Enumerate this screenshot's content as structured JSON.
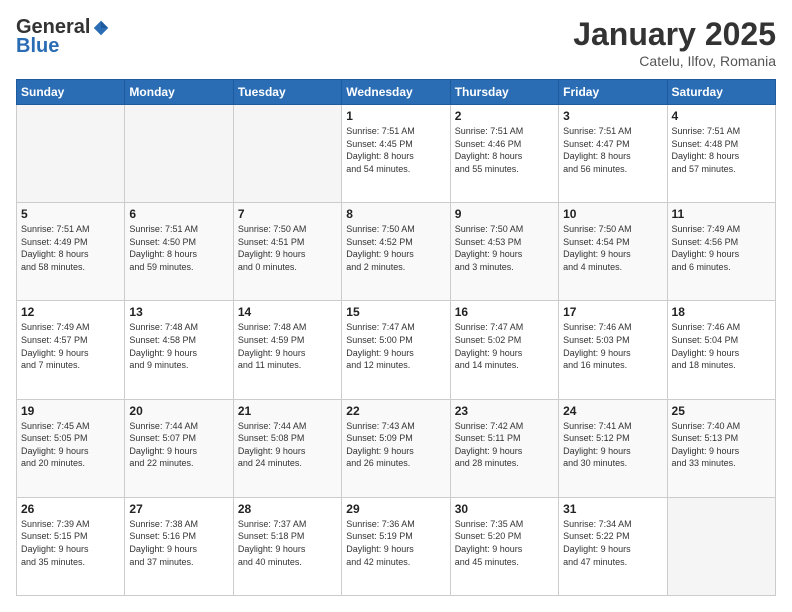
{
  "logo": {
    "general": "General",
    "blue": "Blue"
  },
  "header": {
    "month": "January 2025",
    "location": "Catelu, Ilfov, Romania"
  },
  "weekdays": [
    "Sunday",
    "Monday",
    "Tuesday",
    "Wednesday",
    "Thursday",
    "Friday",
    "Saturday"
  ],
  "weeks": [
    [
      {
        "day": "",
        "info": ""
      },
      {
        "day": "",
        "info": ""
      },
      {
        "day": "",
        "info": ""
      },
      {
        "day": "1",
        "info": "Sunrise: 7:51 AM\nSunset: 4:45 PM\nDaylight: 8 hours\nand 54 minutes."
      },
      {
        "day": "2",
        "info": "Sunrise: 7:51 AM\nSunset: 4:46 PM\nDaylight: 8 hours\nand 55 minutes."
      },
      {
        "day": "3",
        "info": "Sunrise: 7:51 AM\nSunset: 4:47 PM\nDaylight: 8 hours\nand 56 minutes."
      },
      {
        "day": "4",
        "info": "Sunrise: 7:51 AM\nSunset: 4:48 PM\nDaylight: 8 hours\nand 57 minutes."
      }
    ],
    [
      {
        "day": "5",
        "info": "Sunrise: 7:51 AM\nSunset: 4:49 PM\nDaylight: 8 hours\nand 58 minutes."
      },
      {
        "day": "6",
        "info": "Sunrise: 7:51 AM\nSunset: 4:50 PM\nDaylight: 8 hours\nand 59 minutes."
      },
      {
        "day": "7",
        "info": "Sunrise: 7:50 AM\nSunset: 4:51 PM\nDaylight: 9 hours\nand 0 minutes."
      },
      {
        "day": "8",
        "info": "Sunrise: 7:50 AM\nSunset: 4:52 PM\nDaylight: 9 hours\nand 2 minutes."
      },
      {
        "day": "9",
        "info": "Sunrise: 7:50 AM\nSunset: 4:53 PM\nDaylight: 9 hours\nand 3 minutes."
      },
      {
        "day": "10",
        "info": "Sunrise: 7:50 AM\nSunset: 4:54 PM\nDaylight: 9 hours\nand 4 minutes."
      },
      {
        "day": "11",
        "info": "Sunrise: 7:49 AM\nSunset: 4:56 PM\nDaylight: 9 hours\nand 6 minutes."
      }
    ],
    [
      {
        "day": "12",
        "info": "Sunrise: 7:49 AM\nSunset: 4:57 PM\nDaylight: 9 hours\nand 7 minutes."
      },
      {
        "day": "13",
        "info": "Sunrise: 7:48 AM\nSunset: 4:58 PM\nDaylight: 9 hours\nand 9 minutes."
      },
      {
        "day": "14",
        "info": "Sunrise: 7:48 AM\nSunset: 4:59 PM\nDaylight: 9 hours\nand 11 minutes."
      },
      {
        "day": "15",
        "info": "Sunrise: 7:47 AM\nSunset: 5:00 PM\nDaylight: 9 hours\nand 12 minutes."
      },
      {
        "day": "16",
        "info": "Sunrise: 7:47 AM\nSunset: 5:02 PM\nDaylight: 9 hours\nand 14 minutes."
      },
      {
        "day": "17",
        "info": "Sunrise: 7:46 AM\nSunset: 5:03 PM\nDaylight: 9 hours\nand 16 minutes."
      },
      {
        "day": "18",
        "info": "Sunrise: 7:46 AM\nSunset: 5:04 PM\nDaylight: 9 hours\nand 18 minutes."
      }
    ],
    [
      {
        "day": "19",
        "info": "Sunrise: 7:45 AM\nSunset: 5:05 PM\nDaylight: 9 hours\nand 20 minutes."
      },
      {
        "day": "20",
        "info": "Sunrise: 7:44 AM\nSunset: 5:07 PM\nDaylight: 9 hours\nand 22 minutes."
      },
      {
        "day": "21",
        "info": "Sunrise: 7:44 AM\nSunset: 5:08 PM\nDaylight: 9 hours\nand 24 minutes."
      },
      {
        "day": "22",
        "info": "Sunrise: 7:43 AM\nSunset: 5:09 PM\nDaylight: 9 hours\nand 26 minutes."
      },
      {
        "day": "23",
        "info": "Sunrise: 7:42 AM\nSunset: 5:11 PM\nDaylight: 9 hours\nand 28 minutes."
      },
      {
        "day": "24",
        "info": "Sunrise: 7:41 AM\nSunset: 5:12 PM\nDaylight: 9 hours\nand 30 minutes."
      },
      {
        "day": "25",
        "info": "Sunrise: 7:40 AM\nSunset: 5:13 PM\nDaylight: 9 hours\nand 33 minutes."
      }
    ],
    [
      {
        "day": "26",
        "info": "Sunrise: 7:39 AM\nSunset: 5:15 PM\nDaylight: 9 hours\nand 35 minutes."
      },
      {
        "day": "27",
        "info": "Sunrise: 7:38 AM\nSunset: 5:16 PM\nDaylight: 9 hours\nand 37 minutes."
      },
      {
        "day": "28",
        "info": "Sunrise: 7:37 AM\nSunset: 5:18 PM\nDaylight: 9 hours\nand 40 minutes."
      },
      {
        "day": "29",
        "info": "Sunrise: 7:36 AM\nSunset: 5:19 PM\nDaylight: 9 hours\nand 42 minutes."
      },
      {
        "day": "30",
        "info": "Sunrise: 7:35 AM\nSunset: 5:20 PM\nDaylight: 9 hours\nand 45 minutes."
      },
      {
        "day": "31",
        "info": "Sunrise: 7:34 AM\nSunset: 5:22 PM\nDaylight: 9 hours\nand 47 minutes."
      },
      {
        "day": "",
        "info": ""
      }
    ]
  ]
}
